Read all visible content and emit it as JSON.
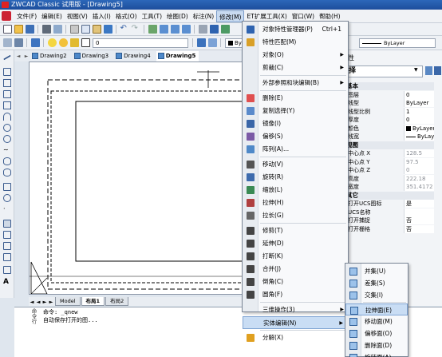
{
  "window": {
    "title": "ZWCAD Classic 试用版 - [Drawing5]"
  },
  "menubar": {
    "items": [
      "文件(F)",
      "编辑(E)",
      "视图(V)",
      "插入(I)",
      "格式(O)",
      "工具(T)",
      "绘图(D)",
      "标注(N)",
      "修改(M)",
      "ET扩展工具(X)",
      "窗口(W)",
      "帮助(H)"
    ],
    "active_index": 8
  },
  "toolbar2": {
    "layer_value": "0",
    "color_value": "ByLayer",
    "linetype_value": "ByLayer"
  },
  "doc_tabs": [
    "Drawing2",
    "Drawing3",
    "Drawing4",
    "Drawing5"
  ],
  "layout_tabs": [
    "Model",
    "布局1",
    "布局2"
  ],
  "command": {
    "side_label": "命令行",
    "lines": [
      "命令: _qnew",
      "自动保存打开的图..."
    ]
  },
  "properties": {
    "title": "性",
    "selection": "择",
    "sections": [
      {
        "name": "基本",
        "rows": [
          {
            "k": "图层",
            "v": "0"
          },
          {
            "k": "线型",
            "v": "ByLayer"
          },
          {
            "k": "线型比例",
            "v": "1"
          },
          {
            "k": "厚度",
            "v": "0"
          },
          {
            "k": "颜色",
            "v": "ByLayer"
          },
          {
            "k": "线宽",
            "v": "ByLayer"
          }
        ]
      },
      {
        "name": "视图",
        "rows": [
          {
            "k": "中心点 X",
            "v": "128.5"
          },
          {
            "k": "中心点 Y",
            "v": "97.5"
          },
          {
            "k": "中心点 Z",
            "v": "0"
          },
          {
            "k": "高度",
            "v": "222.18"
          },
          {
            "k": "宽度",
            "v": "351.4172"
          }
        ]
      },
      {
        "name": "其它",
        "rows": [
          {
            "k": "打开UCS图标",
            "v": "是"
          },
          {
            "k": "UCS名称",
            "v": ""
          },
          {
            "k": "打开捕捉",
            "v": "否"
          },
          {
            "k": "打开栅格",
            "v": "否"
          }
        ]
      }
    ]
  },
  "modify_menu": {
    "items": [
      {
        "label": "对象特性管理器(P)",
        "shortcut": "Ctrl+1",
        "icon": "properties-icon"
      },
      {
        "label": "特性匹配(M)",
        "icon": "match-brush-icon"
      },
      {
        "label": "对象(O)",
        "submenu": true
      },
      {
        "label": "剪裁(C)",
        "submenu": true
      },
      {
        "sep": true
      },
      {
        "label": "外部参照和块编辑(B)",
        "submenu": true
      },
      {
        "sep": true
      },
      {
        "label": "删除(E)",
        "icon": "erase-icon"
      },
      {
        "label": "复制选择(Y)",
        "icon": "copy-icon"
      },
      {
        "label": "镜像(I)",
        "icon": "mirror-icon"
      },
      {
        "label": "偏移(S)",
        "icon": "offset-icon"
      },
      {
        "label": "阵列(A)...",
        "icon": "array-icon"
      },
      {
        "sep": true
      },
      {
        "label": "移动(V)",
        "icon": "move-icon"
      },
      {
        "label": "旋转(R)",
        "icon": "rotate-icon"
      },
      {
        "label": "缩放(L)",
        "icon": "scale-icon"
      },
      {
        "label": "拉伸(H)",
        "icon": "stretch-icon"
      },
      {
        "label": "拉长(G)",
        "icon": "lengthen-icon"
      },
      {
        "sep": true
      },
      {
        "label": "修剪(T)",
        "icon": "trim-icon"
      },
      {
        "label": "延伸(D)",
        "icon": "extend-icon"
      },
      {
        "label": "打断(K)",
        "icon": "break-icon"
      },
      {
        "label": "合并(J)",
        "icon": "join-icon"
      },
      {
        "label": "倒角(C)",
        "icon": "chamfer-icon"
      },
      {
        "label": "圆角(F)",
        "icon": "fillet-icon"
      },
      {
        "sep": true
      },
      {
        "label": "三维操作(3)",
        "submenu": true
      },
      {
        "label": "实体编辑(N)",
        "submenu": true,
        "highlight": true
      },
      {
        "sep": true
      },
      {
        "label": "分解(X)",
        "icon": "explode-icon"
      }
    ]
  },
  "solid_edit_submenu": {
    "items": [
      {
        "label": "并集(U)",
        "icon": "union-icon"
      },
      {
        "label": "差集(S)",
        "icon": "subtract-icon"
      },
      {
        "label": "交集(I)",
        "icon": "intersect-icon"
      },
      {
        "sep": true
      },
      {
        "label": "拉伸面(E)",
        "icon": "extrude-face-icon",
        "highlight": true
      },
      {
        "label": "移动面(M)",
        "icon": "move-face-icon"
      },
      {
        "label": "偏移面(O)",
        "icon": "offset-face-icon"
      },
      {
        "label": "删除面(D)",
        "icon": "delete-face-icon"
      },
      {
        "label": "旋转面(A)",
        "icon": "rotate-face-icon"
      }
    ]
  }
}
